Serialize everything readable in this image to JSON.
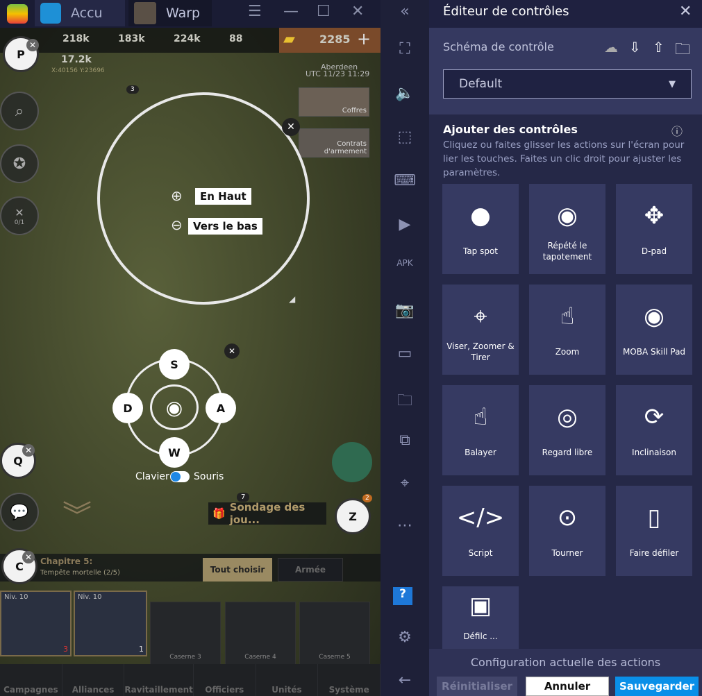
{
  "titlebar": {
    "tabs": [
      {
        "label": "Accu"
      },
      {
        "label": "Warp"
      }
    ],
    "menu_icon": "☰",
    "minimize_icon": "—",
    "maximize_icon": "☐",
    "close_icon": "✕"
  },
  "game": {
    "resources": [
      "218k",
      "183k",
      "224k",
      "88"
    ],
    "gold": "2285",
    "power": "17.2k",
    "coords": "X:40156 Y:23696",
    "location": "Aberdeen",
    "time": "UTC  11/23 11:29",
    "badge_3": "3",
    "events": [
      {
        "label": "Coffres"
      },
      {
        "label": "Contrats d'armement"
      }
    ],
    "keys": {
      "p": "P",
      "q": "Q",
      "c": "C",
      "z": "Z"
    },
    "side_count": "0/1",
    "zoom": {
      "up": "En Haut",
      "down": "Vers le bas"
    },
    "dpad": {
      "up": "S",
      "left": "D",
      "right": "A",
      "down": "W",
      "mode_left": "Clavier",
      "mode_right": "Souris"
    },
    "badge_7": "7",
    "survey": "Sondage des jou...",
    "notif_count": "2",
    "chapter": {
      "title": "Chapitre 5:",
      "subtitle": "Tempête mortelle (2/5)"
    },
    "select_all": "Tout choisir",
    "army": "Armée",
    "units": [
      {
        "level": "Niv. 10",
        "count": "3"
      },
      {
        "level": "Niv. 10",
        "count": "1"
      }
    ],
    "barracks": [
      "Caserne 3",
      "Caserne 4",
      "Caserne 5"
    ],
    "nav": [
      "Campagnes",
      "Alliances",
      "Ravitaillement",
      "Officiers",
      "Unités",
      "Système"
    ]
  },
  "toolbar": {
    "icons": [
      "collapse-icon",
      "fullscreen-icon",
      "volume-icon",
      "select-icon",
      "keyboard-icon",
      "media-icon",
      "apk-icon",
      "screenshot-icon",
      "record-icon",
      "folder-icon",
      "multi-instance-icon",
      "location-icon",
      "more-icon",
      "help-icon",
      "settings-icon",
      "back-icon"
    ]
  },
  "panel": {
    "title": "Éditeur de contrôles",
    "schema_label": "Schéma de contrôle",
    "schema_value": "Default",
    "add_title": "Ajouter des contrôles",
    "add_desc": "Cliquez ou faites glisser les actions sur l'écran pour lier les touches. Faites un clic droit pour ajuster les paramètres.",
    "tiles": [
      {
        "label": "Tap spot",
        "icon": "●"
      },
      {
        "label": "Répété le tapotement",
        "icon": "◉"
      },
      {
        "label": "D-pad",
        "icon": "✥"
      },
      {
        "label": "Viser, Zoomer & Tirer",
        "icon": "⌖"
      },
      {
        "label": "Zoom",
        "icon": "☝"
      },
      {
        "label": "MOBA Skill Pad",
        "icon": "◉"
      },
      {
        "label": "Balayer",
        "icon": "☝"
      },
      {
        "label": "Regard libre",
        "icon": "◎"
      },
      {
        "label": "Inclinaison",
        "icon": "⟳"
      },
      {
        "label": "Script",
        "icon": "</>"
      },
      {
        "label": "Tourner",
        "icon": "⊙"
      },
      {
        "label": "Faire défiler",
        "icon": "▯"
      },
      {
        "label": "Défilc ...",
        "icon": "▣"
      }
    ],
    "footer_title": "Configuration actuelle des actions",
    "reset": "Réinitialiser",
    "cancel": "Annuler",
    "save": "Sauvegarder"
  },
  "colors": {
    "accent": "#0a8fe8",
    "panel": "#252847",
    "tile": "#363a62"
  }
}
